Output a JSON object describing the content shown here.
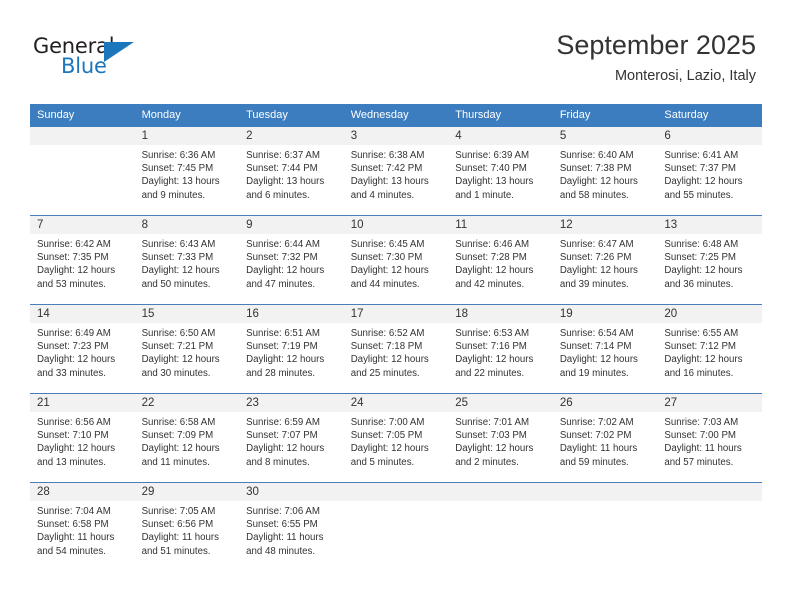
{
  "logo": {
    "primary_text": "General",
    "secondary_text": "Blue",
    "primary_color": "#231f20",
    "secondary_color": "#1c76bc"
  },
  "header": {
    "title": "September 2025",
    "subtitle": "Monterosi, Lazio, Italy"
  },
  "theme": {
    "header_bar_color": "#3b7dbf",
    "day_band_color": "#f2f2f2",
    "week_divider_color": "#4a7ebb",
    "text_color": "#333333"
  },
  "weekday_headers": [
    "Sunday",
    "Monday",
    "Tuesday",
    "Wednesday",
    "Thursday",
    "Friday",
    "Saturday"
  ],
  "weeks": [
    [
      {
        "day": "",
        "empty": true
      },
      {
        "day": "1",
        "sunrise": "Sunrise: 6:36 AM",
        "sunset": "Sunset: 7:45 PM",
        "daylight": "Daylight: 13 hours and 9 minutes."
      },
      {
        "day": "2",
        "sunrise": "Sunrise: 6:37 AM",
        "sunset": "Sunset: 7:44 PM",
        "daylight": "Daylight: 13 hours and 6 minutes."
      },
      {
        "day": "3",
        "sunrise": "Sunrise: 6:38 AM",
        "sunset": "Sunset: 7:42 PM",
        "daylight": "Daylight: 13 hours and 4 minutes."
      },
      {
        "day": "4",
        "sunrise": "Sunrise: 6:39 AM",
        "sunset": "Sunset: 7:40 PM",
        "daylight": "Daylight: 13 hours and 1 minute."
      },
      {
        "day": "5",
        "sunrise": "Sunrise: 6:40 AM",
        "sunset": "Sunset: 7:38 PM",
        "daylight": "Daylight: 12 hours and 58 minutes."
      },
      {
        "day": "6",
        "sunrise": "Sunrise: 6:41 AM",
        "sunset": "Sunset: 7:37 PM",
        "daylight": "Daylight: 12 hours and 55 minutes."
      }
    ],
    [
      {
        "day": "7",
        "sunrise": "Sunrise: 6:42 AM",
        "sunset": "Sunset: 7:35 PM",
        "daylight": "Daylight: 12 hours and 53 minutes."
      },
      {
        "day": "8",
        "sunrise": "Sunrise: 6:43 AM",
        "sunset": "Sunset: 7:33 PM",
        "daylight": "Daylight: 12 hours and 50 minutes."
      },
      {
        "day": "9",
        "sunrise": "Sunrise: 6:44 AM",
        "sunset": "Sunset: 7:32 PM",
        "daylight": "Daylight: 12 hours and 47 minutes."
      },
      {
        "day": "10",
        "sunrise": "Sunrise: 6:45 AM",
        "sunset": "Sunset: 7:30 PM",
        "daylight": "Daylight: 12 hours and 44 minutes."
      },
      {
        "day": "11",
        "sunrise": "Sunrise: 6:46 AM",
        "sunset": "Sunset: 7:28 PM",
        "daylight": "Daylight: 12 hours and 42 minutes."
      },
      {
        "day": "12",
        "sunrise": "Sunrise: 6:47 AM",
        "sunset": "Sunset: 7:26 PM",
        "daylight": "Daylight: 12 hours and 39 minutes."
      },
      {
        "day": "13",
        "sunrise": "Sunrise: 6:48 AM",
        "sunset": "Sunset: 7:25 PM",
        "daylight": "Daylight: 12 hours and 36 minutes."
      }
    ],
    [
      {
        "day": "14",
        "sunrise": "Sunrise: 6:49 AM",
        "sunset": "Sunset: 7:23 PM",
        "daylight": "Daylight: 12 hours and 33 minutes."
      },
      {
        "day": "15",
        "sunrise": "Sunrise: 6:50 AM",
        "sunset": "Sunset: 7:21 PM",
        "daylight": "Daylight: 12 hours and 30 minutes."
      },
      {
        "day": "16",
        "sunrise": "Sunrise: 6:51 AM",
        "sunset": "Sunset: 7:19 PM",
        "daylight": "Daylight: 12 hours and 28 minutes."
      },
      {
        "day": "17",
        "sunrise": "Sunrise: 6:52 AM",
        "sunset": "Sunset: 7:18 PM",
        "daylight": "Daylight: 12 hours and 25 minutes."
      },
      {
        "day": "18",
        "sunrise": "Sunrise: 6:53 AM",
        "sunset": "Sunset: 7:16 PM",
        "daylight": "Daylight: 12 hours and 22 minutes."
      },
      {
        "day": "19",
        "sunrise": "Sunrise: 6:54 AM",
        "sunset": "Sunset: 7:14 PM",
        "daylight": "Daylight: 12 hours and 19 minutes."
      },
      {
        "day": "20",
        "sunrise": "Sunrise: 6:55 AM",
        "sunset": "Sunset: 7:12 PM",
        "daylight": "Daylight: 12 hours and 16 minutes."
      }
    ],
    [
      {
        "day": "21",
        "sunrise": "Sunrise: 6:56 AM",
        "sunset": "Sunset: 7:10 PM",
        "daylight": "Daylight: 12 hours and 13 minutes."
      },
      {
        "day": "22",
        "sunrise": "Sunrise: 6:58 AM",
        "sunset": "Sunset: 7:09 PM",
        "daylight": "Daylight: 12 hours and 11 minutes."
      },
      {
        "day": "23",
        "sunrise": "Sunrise: 6:59 AM",
        "sunset": "Sunset: 7:07 PM",
        "daylight": "Daylight: 12 hours and 8 minutes."
      },
      {
        "day": "24",
        "sunrise": "Sunrise: 7:00 AM",
        "sunset": "Sunset: 7:05 PM",
        "daylight": "Daylight: 12 hours and 5 minutes."
      },
      {
        "day": "25",
        "sunrise": "Sunrise: 7:01 AM",
        "sunset": "Sunset: 7:03 PM",
        "daylight": "Daylight: 12 hours and 2 minutes."
      },
      {
        "day": "26",
        "sunrise": "Sunrise: 7:02 AM",
        "sunset": "Sunset: 7:02 PM",
        "daylight": "Daylight: 11 hours and 59 minutes."
      },
      {
        "day": "27",
        "sunrise": "Sunrise: 7:03 AM",
        "sunset": "Sunset: 7:00 PM",
        "daylight": "Daylight: 11 hours and 57 minutes."
      }
    ],
    [
      {
        "day": "28",
        "sunrise": "Sunrise: 7:04 AM",
        "sunset": "Sunset: 6:58 PM",
        "daylight": "Daylight: 11 hours and 54 minutes."
      },
      {
        "day": "29",
        "sunrise": "Sunrise: 7:05 AM",
        "sunset": "Sunset: 6:56 PM",
        "daylight": "Daylight: 11 hours and 51 minutes."
      },
      {
        "day": "30",
        "sunrise": "Sunrise: 7:06 AM",
        "sunset": "Sunset: 6:55 PM",
        "daylight": "Daylight: 11 hours and 48 minutes."
      },
      {
        "day": "",
        "empty": true
      },
      {
        "day": "",
        "empty": true
      },
      {
        "day": "",
        "empty": true
      },
      {
        "day": "",
        "empty": true
      }
    ]
  ]
}
